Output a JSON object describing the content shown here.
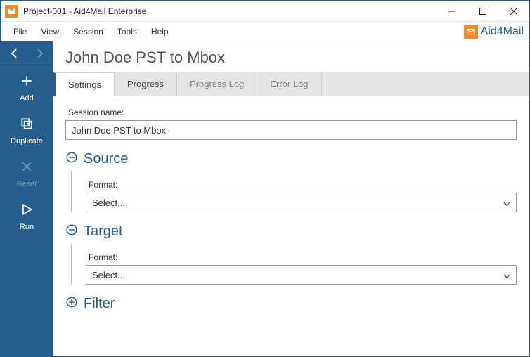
{
  "titlebar": {
    "title": "Project-001 - Aid4Mail Enterprise"
  },
  "menubar": {
    "items": [
      "File",
      "View",
      "Session",
      "Tools",
      "Help"
    ],
    "brand": "Aid4Mail"
  },
  "sidebar": {
    "add": "Add",
    "duplicate": "Duplicate",
    "reset": "Reset",
    "run": "Run"
  },
  "main": {
    "heading": "John Doe PST to Mbox",
    "tabs": {
      "settings": "Settings",
      "progress": "Progress",
      "progress_log": "Progress Log",
      "error_log": "Error Log"
    },
    "session_name_label": "Session name:",
    "session_name_value": "John Doe PST to Mbox",
    "source": {
      "title": "Source",
      "format_label": "Format:",
      "format_value": "Select..."
    },
    "target": {
      "title": "Target",
      "format_label": "Format:",
      "format_value": "Select..."
    },
    "filter": {
      "title": "Filter"
    }
  }
}
